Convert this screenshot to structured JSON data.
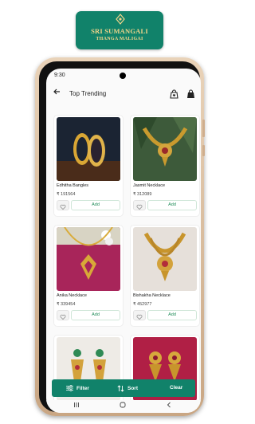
{
  "logo": {
    "line1": "SRI SUMANGALI",
    "line2": "THANGA MALIGAI"
  },
  "status_bar": {
    "time": "9:30"
  },
  "header": {
    "title": "Top Trending"
  },
  "products": [
    {
      "name": "Edhitha Bangles",
      "price": "₹ 191564",
      "add_label": "Add"
    },
    {
      "name": "Jasmit Necklace",
      "price": "₹ 312089",
      "add_label": "Add"
    },
    {
      "name": "Anika Necklace",
      "price": "₹ 339454",
      "add_label": "Add"
    },
    {
      "name": "Bishakha Necklace",
      "price": "₹ 452977",
      "add_label": "Add"
    }
  ],
  "bottom_bar": {
    "filter_label": "Filter",
    "sort_label": "Sort",
    "clear_label": "Clear"
  },
  "colors": {
    "brand": "#11826a",
    "logo_text": "#f3d58a",
    "add_text": "#1a8a55"
  },
  "icons": [
    "back-arrow-icon",
    "wishlist-bag-icon",
    "cart-bag-icon",
    "heart-icon",
    "filter-icon",
    "sort-icon"
  ]
}
